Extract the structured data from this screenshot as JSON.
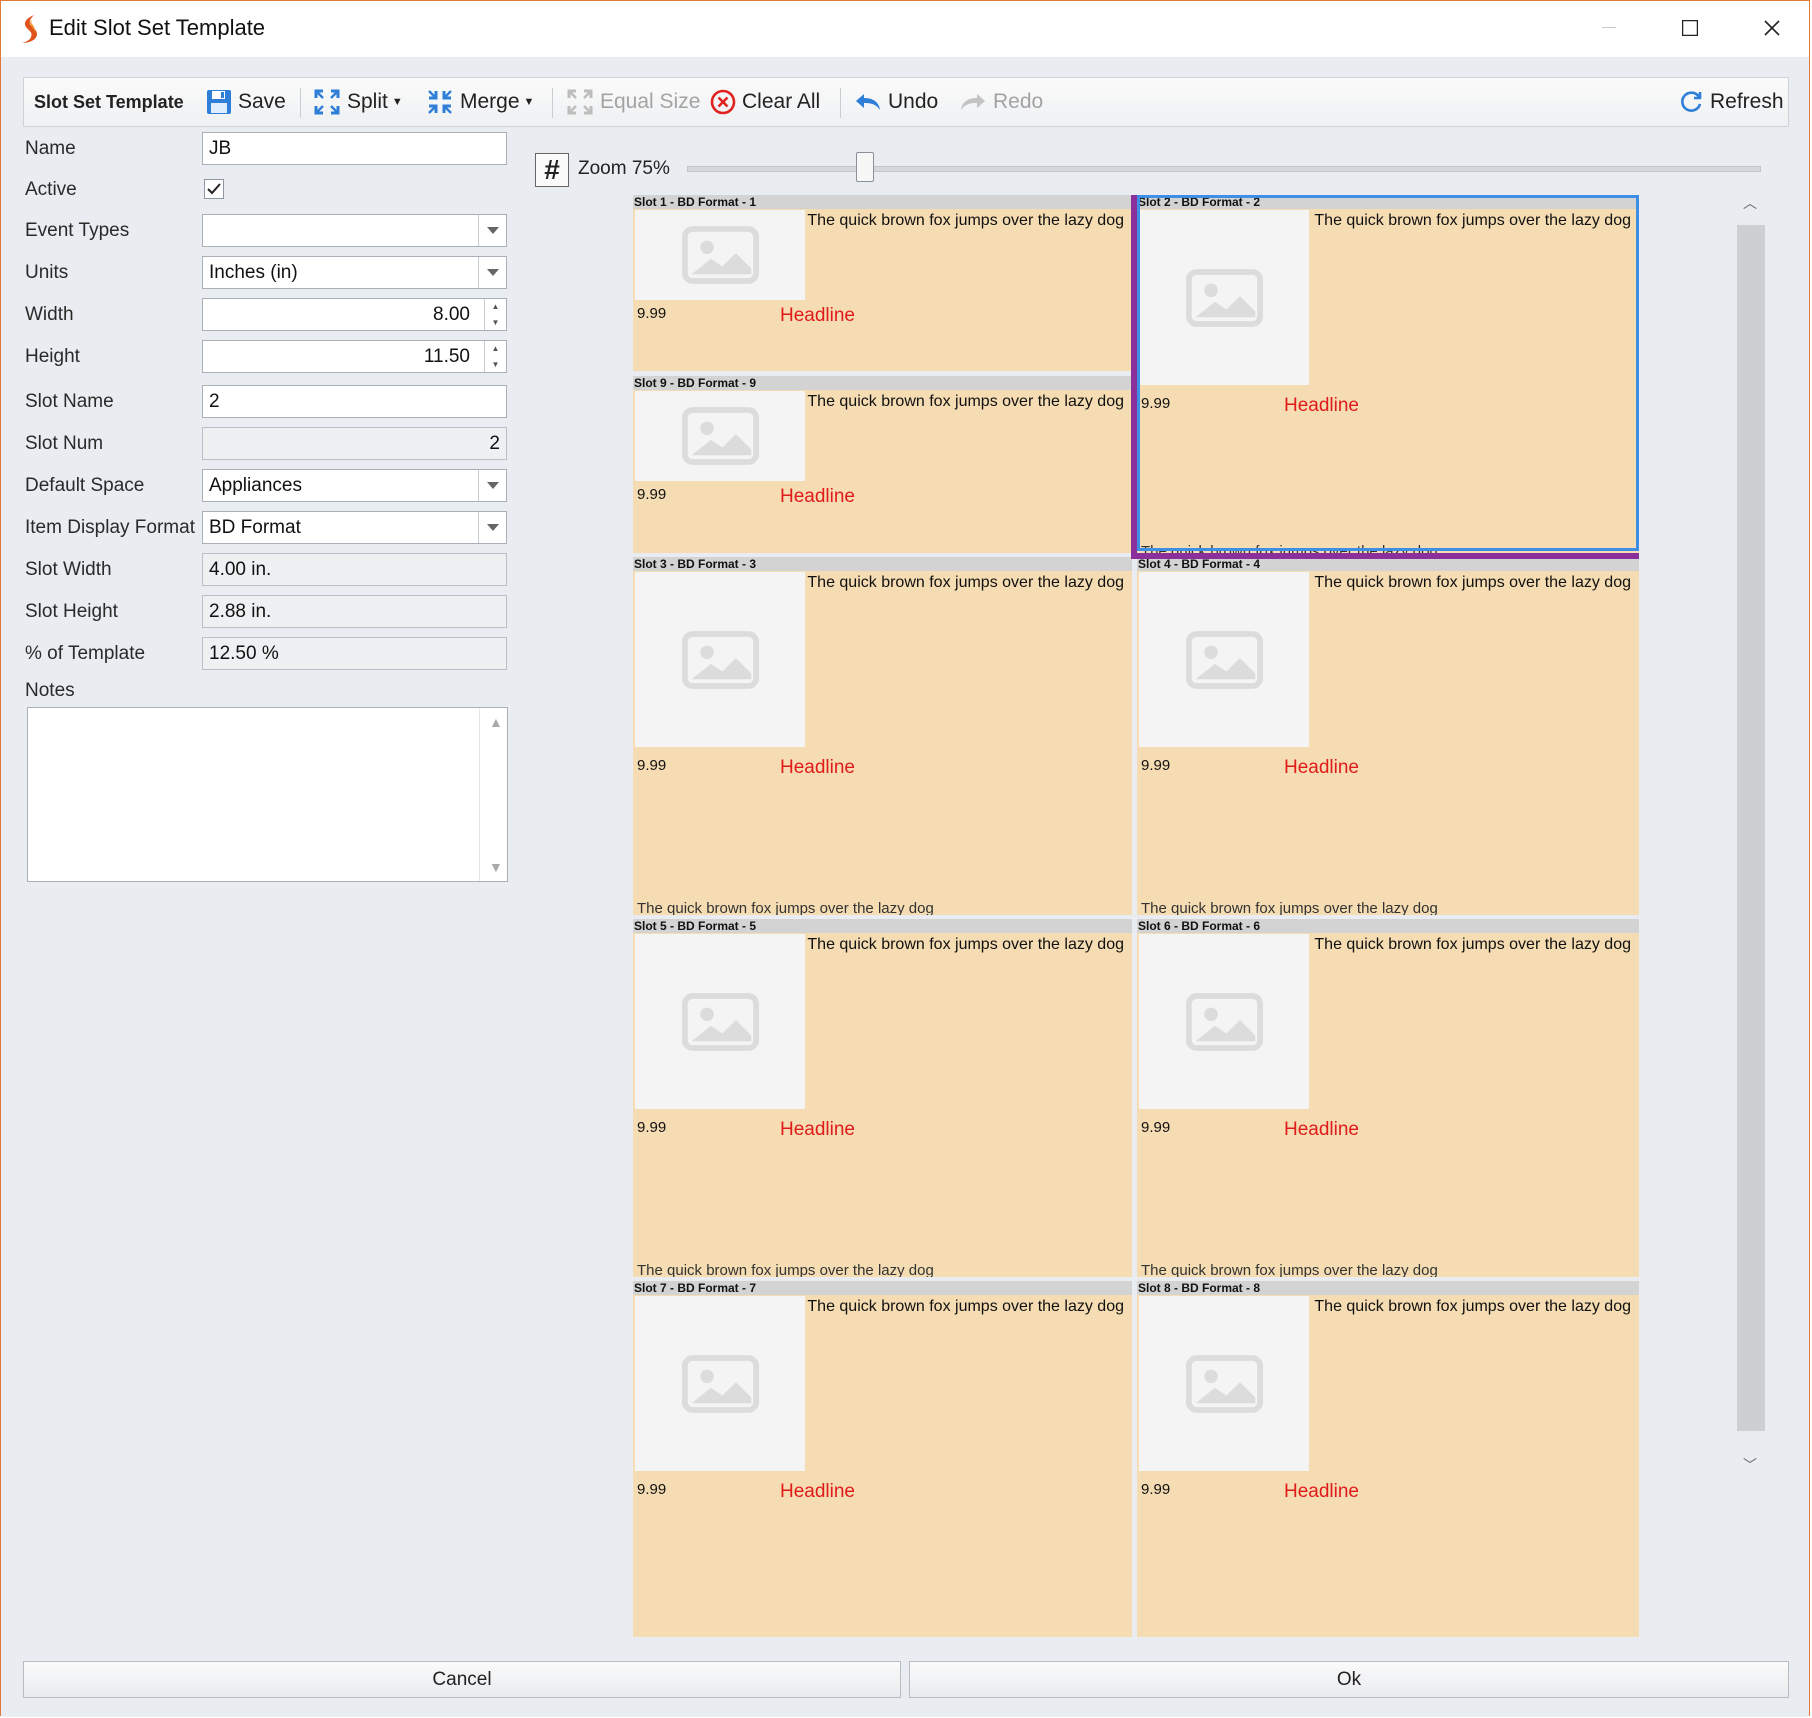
{
  "window": {
    "title": "Edit Slot Set Template"
  },
  "toolbar": {
    "section_title": "Slot Set Template",
    "save": "Save",
    "split": "Split",
    "merge": "Merge",
    "equal_size": "Equal Size",
    "clear_all": "Clear All",
    "undo": "Undo",
    "redo": "Redo",
    "refresh": "Refresh"
  },
  "form": {
    "name": {
      "label": "Name",
      "value": "JB"
    },
    "active": {
      "label": "Active",
      "checked": true
    },
    "event_types": {
      "label": "Event Types",
      "value": ""
    },
    "units": {
      "label": "Units",
      "value": "Inches (in)"
    },
    "width": {
      "label": "Width",
      "value": "8.00"
    },
    "height": {
      "label": "Height",
      "value": "11.50"
    },
    "slot_name": {
      "label": "Slot Name",
      "value": "2"
    },
    "slot_num": {
      "label": "Slot Num",
      "value": "2"
    },
    "default_space": {
      "label": "Default Space",
      "value": "Appliances"
    },
    "item_display_format": {
      "label": "Item Display Format",
      "value": "BD Format"
    },
    "slot_width": {
      "label": "Slot Width",
      "value": "4.00 in."
    },
    "slot_height": {
      "label": "Slot Height",
      "value": "2.88 in."
    },
    "pct_template": {
      "label": "% of Template",
      "value": "12.50 %"
    },
    "notes": {
      "label": "Notes",
      "value": ""
    }
  },
  "canvas": {
    "grid_symbol": "#",
    "zoom_label": "Zoom 75%",
    "zoom_level_percent": 75,
    "selected_slot": "Slot 2 - BD Format - 2"
  },
  "slots": [
    {
      "header": "Slot 1 - BD Format - 1",
      "desc": "The quick brown fox jumps over the lazy dog",
      "price": "9.99",
      "headline": "Headline",
      "footer": ""
    },
    {
      "header": "Slot 2 - BD Format - 2",
      "desc": "The quick brown fox jumps over the lazy dog",
      "price": "9.99",
      "headline": "Headline",
      "footer": "The quick brown fox jumps over the lazy dog"
    },
    {
      "header": "Slot 9 - BD Format - 9",
      "desc": "The quick brown fox jumps over the lazy dog",
      "price": "9.99",
      "headline": "Headline",
      "footer": ""
    },
    {
      "header": "Slot 3 - BD Format - 3",
      "desc": "The quick brown fox jumps over the lazy dog",
      "price": "9.99",
      "headline": "Headline",
      "footer": "The quick brown fox jumps over the lazy dog"
    },
    {
      "header": "Slot 4 - BD Format - 4",
      "desc": "The quick brown fox jumps over the lazy dog",
      "price": "9.99",
      "headline": "Headline",
      "footer": "The quick brown fox jumps over the lazy dog"
    },
    {
      "header": "Slot 5 - BD Format - 5",
      "desc": "The quick brown fox jumps over the lazy dog",
      "price": "9.99",
      "headline": "Headline",
      "footer": "The quick brown fox jumps over the lazy dog"
    },
    {
      "header": "Slot 6 - BD Format - 6",
      "desc": "The quick brown fox jumps over the lazy dog",
      "price": "9.99",
      "headline": "Headline",
      "footer": "The quick brown fox jumps over the lazy dog"
    },
    {
      "header": "Slot 7 - BD Format - 7",
      "desc": "The quick brown fox jumps over the lazy dog",
      "price": "9.99",
      "headline": "Headline",
      "footer": ""
    },
    {
      "header": "Slot 8 - BD Format - 8",
      "desc": "The quick brown fox jumps over the lazy dog",
      "price": "9.99",
      "headline": "Headline",
      "footer": ""
    }
  ],
  "buttons": {
    "cancel": "Cancel",
    "ok": "Ok"
  },
  "colors": {
    "slot_background": "#f5dcb2",
    "slot_header": "#d3d3d3",
    "headline": "#e01b1b",
    "selection": "#3e8ee6",
    "merge_highlight": "#8b2f9a",
    "window_border": "#e07a3a"
  },
  "icons": {
    "app": "app-logo-icon",
    "save": "floppy-disk-icon",
    "split": "split-arrows-icon",
    "merge": "merge-arrows-icon",
    "equal_size": "equal-size-icon",
    "clear_all": "clear-circle-x-icon",
    "undo": "undo-arrow-icon",
    "redo": "redo-arrow-icon",
    "refresh": "refresh-icon",
    "placeholder": "image-placeholder-icon"
  }
}
